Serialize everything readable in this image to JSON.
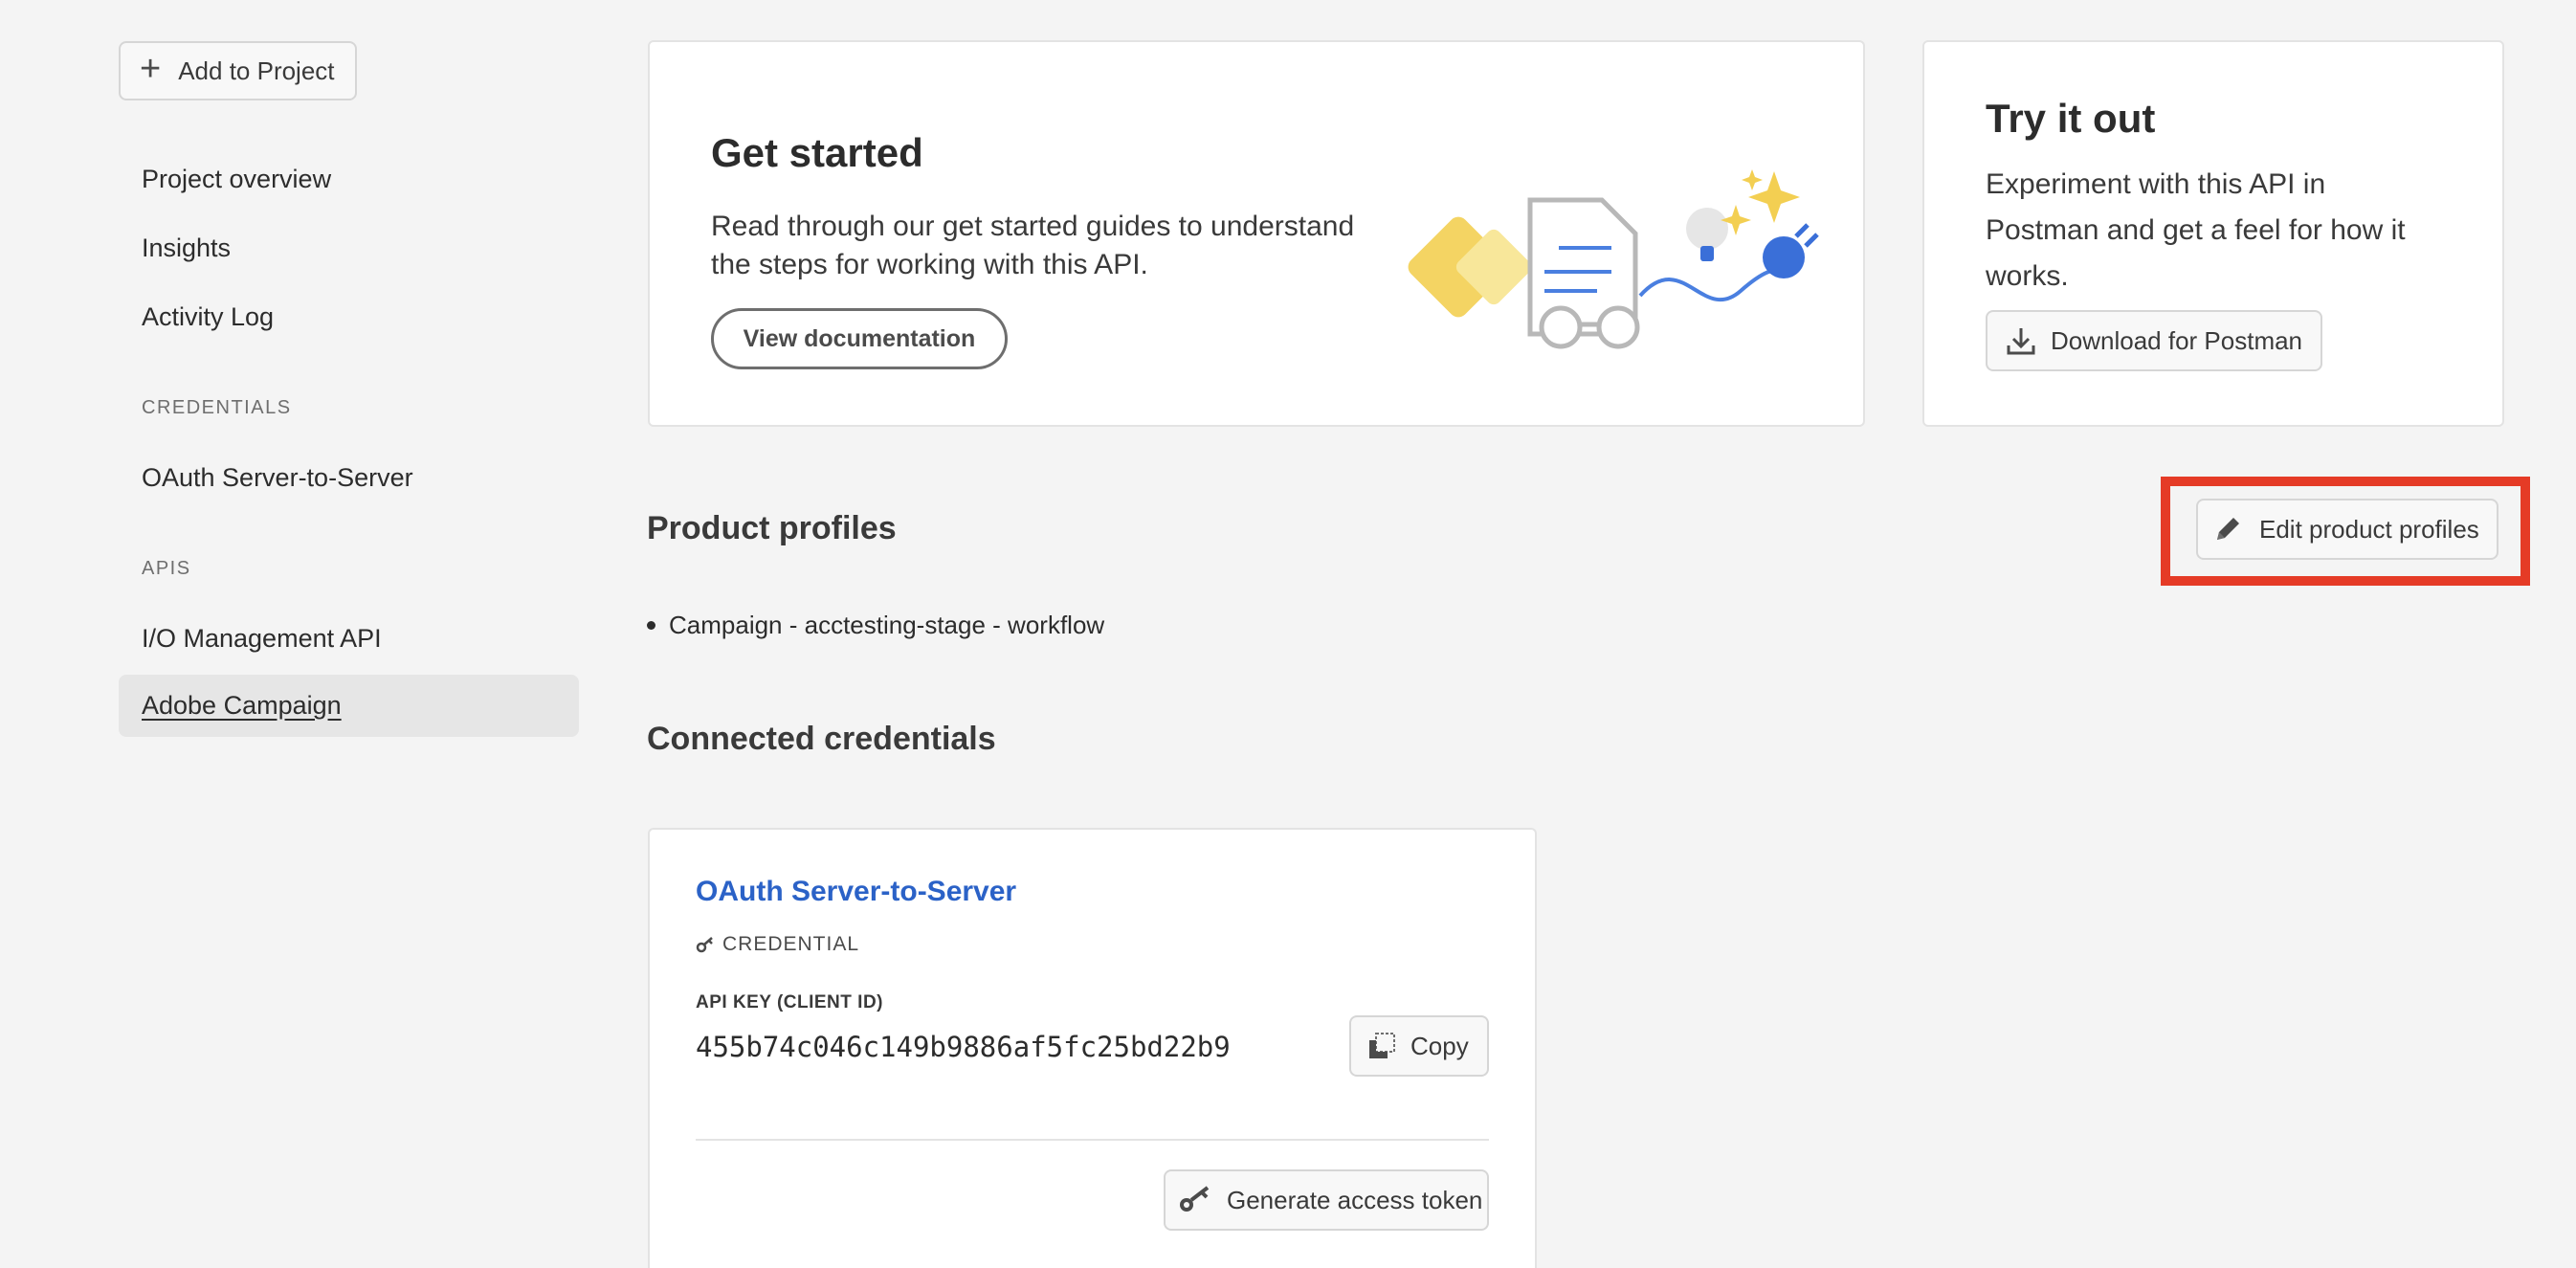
{
  "sidebar": {
    "add_button": "Add to Project",
    "items": [
      "Project overview",
      "Insights",
      "Activity Log"
    ],
    "credentials_section": "CREDENTIALS",
    "credential_items": [
      "OAuth Server-to-Server"
    ],
    "apis_section": "APIS",
    "api_items": [
      "I/O Management API",
      "Adobe Campaign"
    ]
  },
  "get_started": {
    "title": "Get started",
    "description": "Read through our get started guides to understand the steps for working with this API.",
    "button": "View documentation"
  },
  "try_it_out": {
    "title": "Try it out",
    "description": "Experiment with this API in Postman and get a feel for how it works.",
    "button": "Download for Postman"
  },
  "product_profiles": {
    "title": "Product profiles",
    "edit_button": "Edit product profiles",
    "items": [
      "Campaign - acctesting-stage - workflow"
    ]
  },
  "connected_credentials": {
    "title": "Connected credentials",
    "card": {
      "name": "OAuth Server-to-Server",
      "type": "CREDENTIAL",
      "api_key_label": "API KEY (CLIENT ID)",
      "api_key_value": "455b74c046c149b9886af5fc25bd22b9",
      "copy_button": "Copy",
      "generate_button": "Generate access token"
    }
  },
  "colors": {
    "background": "#f4f4f4",
    "link_blue": "#2b62c7",
    "highlight_red": "#e53b26"
  },
  "icons": [
    "plus-icon",
    "download-icon",
    "pencil-icon",
    "key-icon",
    "copy-icon"
  ]
}
